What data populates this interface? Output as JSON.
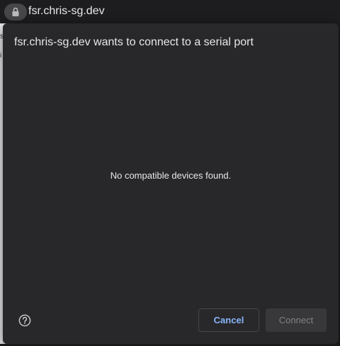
{
  "url_bar": {
    "url": "fsr.chris-sg.dev",
    "lock_icon": "lock-icon"
  },
  "dialog": {
    "title": "fsr.chris-sg.dev wants to connect to a serial port",
    "empty_message": "No compatible devices found.",
    "help_icon": "help-circle-icon",
    "cancel_label": "Cancel",
    "connect_label": "Connect",
    "connect_enabled": false
  },
  "colors": {
    "dialog_bg": "#28282b",
    "accent": "#8ab4f8",
    "disabled_text": "#828285"
  }
}
